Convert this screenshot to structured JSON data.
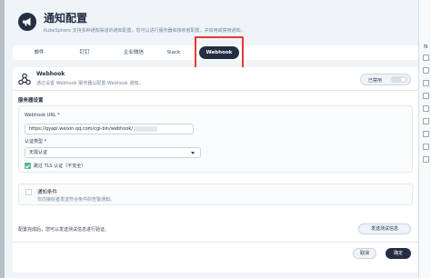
{
  "header": {
    "title": "通知配置",
    "description": "KubeSphere 支持多种通知渠道的通知配置，您可以进行服务器和接收者配置，并启用或禁用通知。"
  },
  "tabs": [
    {
      "label": "邮件",
      "active": false
    },
    {
      "label": "钉钉",
      "active": false
    },
    {
      "label": "企业微信",
      "active": false
    },
    {
      "label": "Slack",
      "active": false
    },
    {
      "label": "Webhook",
      "active": true
    }
  ],
  "webhook": {
    "title": "Webhook",
    "description": "通过设置 Webhook 服务器以配置 Webhook 通知。",
    "toggle_label": "已禁用",
    "enabled": false
  },
  "server": {
    "section_title": "服务器设置",
    "url_label": "Webhook URL *",
    "url_value": "https://qyapi.weixin.qq.com/cgi-bin/webhook/",
    "auth_label": "认证类型 *",
    "auth_value": "无需认证",
    "skip_tls_label": "跳过 TLS 认证（不安全）",
    "skip_tls_checked": true
  },
  "filter": {
    "title": "通知条件",
    "description": "仅向接收者发送符合条件的告警通知。",
    "checked": false
  },
  "test": {
    "text": "配置完成后，您可以发送测试信息进行验证。",
    "button_label": "发送测试信息"
  },
  "footer": {
    "cancel_label": "取消",
    "confirm_label": "确定"
  },
  "right_panel": {
    "letter": "N"
  },
  "colors": {
    "dark": "#242e42",
    "background": "#eff4f9",
    "accent_green": "#55bc8a",
    "highlight_red": "#e53935"
  }
}
